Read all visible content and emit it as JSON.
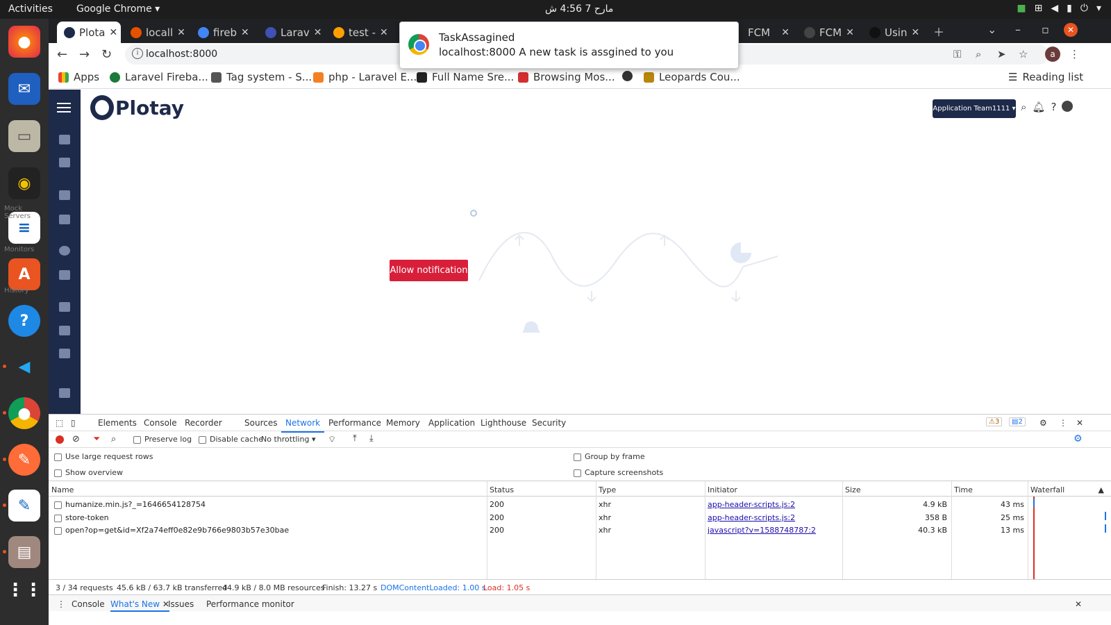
{
  "system": {
    "activities": "Activities",
    "app_name": "Google Chrome",
    "clock": "مارح 7  4:56 ش"
  },
  "dock": {
    "labels": [
      "Mock Servers",
      "Monitors",
      "History"
    ]
  },
  "tabs": [
    {
      "label": "Plota",
      "color": "#1e2a4a",
      "active": true
    },
    {
      "label": "locall",
      "color": "#e65100"
    },
    {
      "label": "fireb",
      "color": "#4285f4"
    },
    {
      "label": "Larav",
      "color": "#3f51b5"
    },
    {
      "label": "test -",
      "color": "#ffa000"
    },
    {
      "label": "FCM",
      "color": "#666"
    },
    {
      "label": "FCM",
      "color": "#444"
    },
    {
      "label": "Usin",
      "color": "#111"
    }
  ],
  "omnibox": {
    "url": "localhost:8000",
    "avatar": "a"
  },
  "bookmarks": {
    "items": [
      "Apps",
      "Laravel Fireba...",
      "Tag system - S...",
      "php - Laravel E...",
      "Full Name Sre...",
      "Browsing Mos...",
      "Leopards Cou..."
    ],
    "reading_list": "Reading list"
  },
  "page": {
    "logo": "Plotay",
    "team_button": "Application Team1111",
    "allow_button": "Allow notification"
  },
  "notification": {
    "title": "TaskAssagined",
    "origin": "localhost:8000",
    "body": "A new task is assgined to you"
  },
  "devtools": {
    "tabs": [
      "Elements",
      "Console",
      "Recorder",
      "Sources",
      "Network",
      "Performance",
      "Memory",
      "Application",
      "Lighthouse",
      "Security"
    ],
    "active_tab": "Network",
    "warnings": "3",
    "messages": "2",
    "toolbar": {
      "preserve_log": "Preserve log",
      "disable_cache": "Disable cache",
      "throttling": "No throttling"
    },
    "options": {
      "large_rows": "Use large request rows",
      "show_overview": "Show overview",
      "group_by_frame": "Group by frame",
      "capture_screenshots": "Capture screenshots"
    },
    "columns": [
      "Name",
      "Status",
      "Type",
      "Initiator",
      "Size",
      "Time",
      "Waterfall"
    ],
    "rows": [
      {
        "name": "humanize.min.js?_=1646654128754",
        "status": "200",
        "type": "xhr",
        "initiator": "app-header-scripts.js:2",
        "size": "4.9 kB",
        "time": "43 ms"
      },
      {
        "name": "store-token",
        "status": "200",
        "type": "xhr",
        "initiator": "app-header-scripts.js:2",
        "size": "358 B",
        "time": "25 ms"
      },
      {
        "name": "open?op=get&id=Xf2a74eff0e82e9b766e9803b57e30bae",
        "status": "200",
        "type": "xhr",
        "initiator": "javascript?v=1588748787:2",
        "size": "40.3 kB",
        "time": "13 ms"
      }
    ],
    "summary": {
      "requests": "3 / 34 requests",
      "transferred": "45.6 kB / 63.7 kB transferred",
      "resources": "44.9 kB / 8.0 MB resources",
      "finish": "Finish: 13.27 s",
      "dcl": "DOMContentLoaded: 1.00 s",
      "load": "Load: 1.05 s"
    },
    "drawer": [
      "Console",
      "What's New",
      "Issues",
      "Performance monitor"
    ]
  }
}
